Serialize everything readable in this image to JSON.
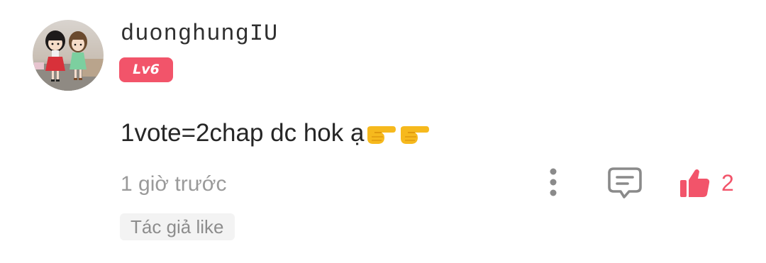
{
  "comment": {
    "username": "duonghungIU",
    "level_badge": "Lv6",
    "text": "1vote=2chap dc hok ạ",
    "emoji_icons": [
      "pointing-right-hand-icon",
      "pointing-right-hand-icon"
    ],
    "timestamp": "1 giờ trước",
    "actions": {
      "more_icon": "vertical-dots-icon",
      "reply_icon": "comment-bubble-icon",
      "like_icon": "thumbs-up-icon",
      "like_count": "2"
    },
    "author_liked_tag": "Tác giả like"
  },
  "colors": {
    "accent": "#f2546a",
    "username": "#2f2f2f",
    "body_text": "#262626",
    "muted_text": "#9a9a9a",
    "icon_gray": "#8a8a8a",
    "tag_background": "#f3f3f3"
  }
}
